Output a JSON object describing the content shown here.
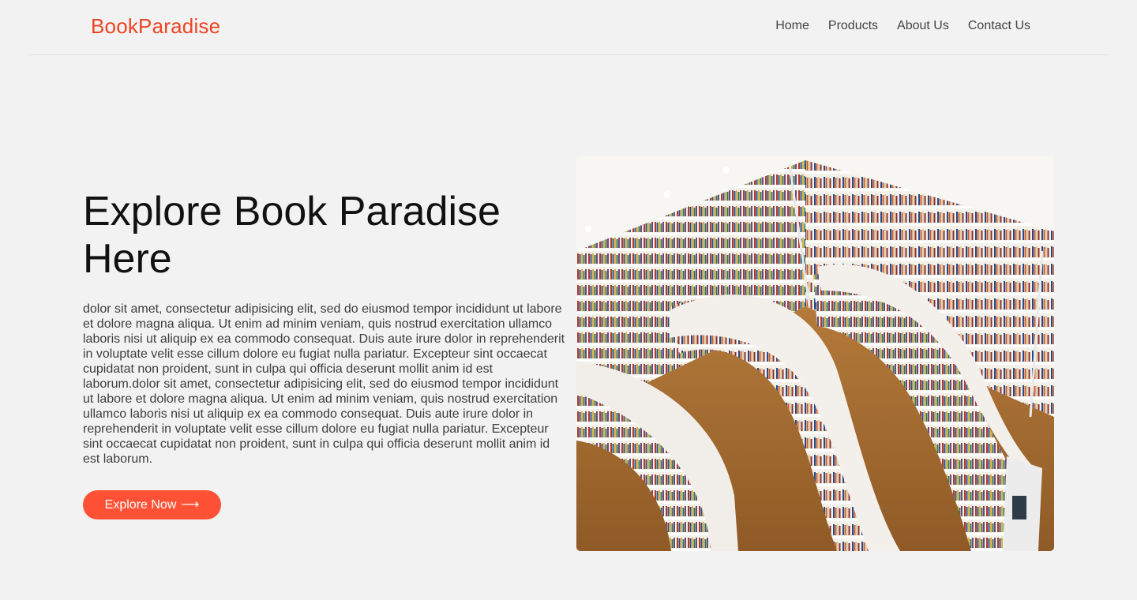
{
  "brand": {
    "name": "BookParadise"
  },
  "nav": [
    {
      "label": "Home"
    },
    {
      "label": "Products"
    },
    {
      "label": "About Us"
    },
    {
      "label": "Contact Us"
    }
  ],
  "hero": {
    "title": "Explore Book Paradise Here",
    "body": "dolor sit amet, consectetur adipisicing elit, sed do eiusmod tempor incididunt ut labore et dolore magna aliqua. Ut enim ad minim veniam, quis nostrud exercitation ullamco laboris nisi ut aliquip ex ea commodo consequat. Duis aute irure dolor in reprehenderit in voluptate velit esse cillum dolore eu fugiat nulla pariatur. Excepteur sint occaecat cupidatat non proident, sunt in culpa qui officia deserunt mollit anim id est laborum.dolor sit amet, consectetur adipisicing elit, sed do eiusmod tempor incididunt ut labore et dolore magna aliqua. Ut enim ad minim veniam, quis nostrud exercitation ullamco laboris nisi ut aliquip ex ea commodo consequat. Duis aute irure dolor in reprehenderit in voluptate velit esse cillum dolore eu fugiat nulla pariatur. Excepteur sint occaecat cupidatat non proident, sunt in culpa qui officia deserunt mollit anim id est laborum.",
    "cta_label": "Explore Now",
    "cta_icon": "arrow-right-icon",
    "image_subject": "library-bookshelves-photo"
  },
  "colors": {
    "brand": "#ee4423",
    "cta_background": "#ff5135",
    "page_background": "#f2f2f2",
    "heading": "#111111",
    "body_text": "#3d3d3d",
    "nav_text": "#444444"
  }
}
